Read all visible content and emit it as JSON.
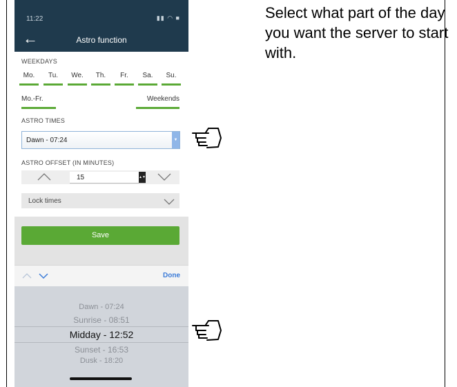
{
  "status": {
    "time": "11:22",
    "icons": "▮▮ ◠ ■"
  },
  "appbar": {
    "title": "Astro function"
  },
  "weekdays": {
    "label": "WEEKDAYS",
    "days": [
      "Mo.",
      "Tu.",
      "We.",
      "Th.",
      "Fr.",
      "Sa.",
      "Su."
    ],
    "mo_fr": "Mo.-Fr.",
    "weekends": "Weekends",
    "active_color": "#5aa935"
  },
  "astro_times": {
    "label": "ASTRO TIMES",
    "selected": "Dawn - 07:24"
  },
  "astro_offset": {
    "label": "ASTRO OFFSET (IN MINUTES)",
    "value": "15"
  },
  "lock_times": {
    "label": "Lock times"
  },
  "save": {
    "label": "Save",
    "color": "#5aa935"
  },
  "picker": {
    "done": "Done",
    "options": [
      "Dawn - 07:24",
      "Sunrise - 08:51",
      "Midday - 12:52",
      "Sunset - 16:53",
      "Dusk - 18:20"
    ],
    "selected_index": 2
  },
  "instruction": "Select what part of the day you want the server to start with.",
  "icons": {
    "back": "back-arrow-icon",
    "pointer": "pointing-hand-icon"
  },
  "colors": {
    "appbar": "#1f3a4d",
    "accent_blue": "#3b7bd8"
  }
}
